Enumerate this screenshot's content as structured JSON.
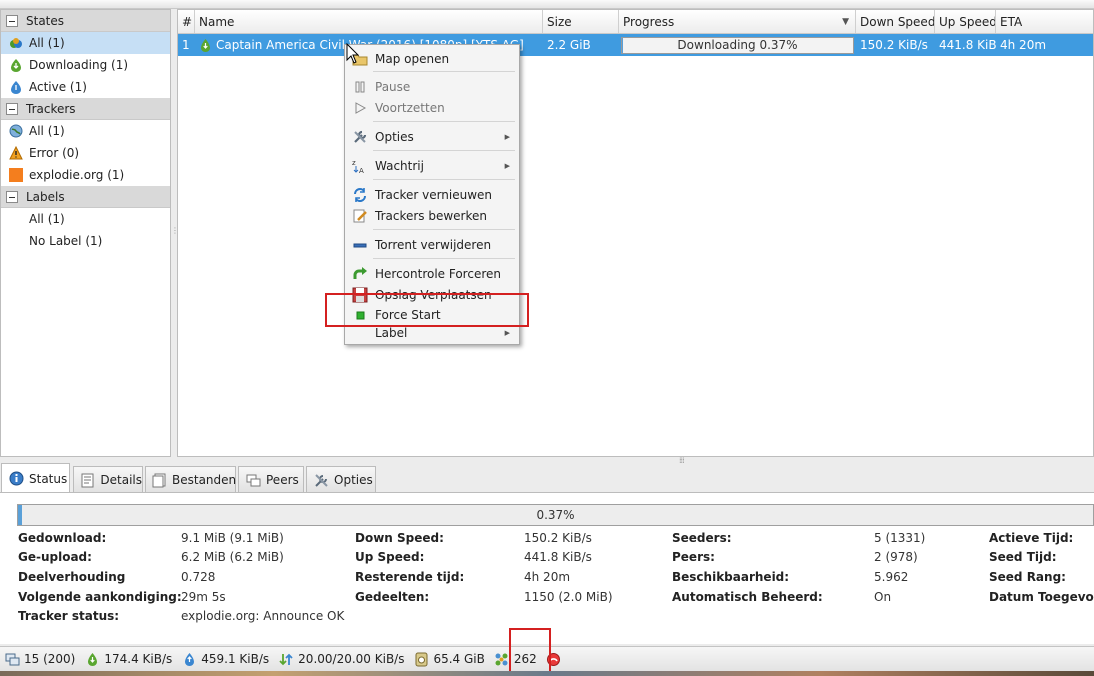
{
  "sidebar": {
    "states_title": "States",
    "states": [
      {
        "label": "All (1)"
      },
      {
        "label": "Downloading (1)"
      },
      {
        "label": "Active (1)"
      }
    ],
    "trackers_title": "Trackers",
    "trackers": [
      {
        "label": "All (1)"
      },
      {
        "label": "Error (0)"
      },
      {
        "label": "explodie.org (1)"
      }
    ],
    "labels_title": "Labels",
    "labels": [
      {
        "label": "All (1)"
      },
      {
        "label": "No Label (1)"
      }
    ]
  },
  "table": {
    "columns": [
      "#",
      "Name",
      "Size",
      "Progress",
      "Down Speed",
      "Up Speed",
      "ETA"
    ],
    "rows": [
      {
        "num": "1",
        "name": "Captain America Civil War (2016) [1080p] [YTS.AG]",
        "size": "2.2 GiB",
        "progress_text": "Downloading 0.37%",
        "progress": 0.0037,
        "down": "150.2 KiB/s",
        "up": "441.8 KiB/s",
        "eta": "4h 20m"
      }
    ]
  },
  "context_menu": {
    "items": {
      "open_folder": "Map openen",
      "pause": "Pause",
      "resume": "Voortzetten",
      "options": "Opties",
      "queue": "Wachtrij",
      "update_tracker": "Tracker vernieuwen",
      "edit_trackers": "Trackers bewerken",
      "remove_torrent": "Torrent verwijderen",
      "force_recheck": "Hercontrole Forceren",
      "move_storage": "Opslag Verplaatsen",
      "force_start": "Force Start",
      "label": "Label"
    }
  },
  "tabs": [
    "Status",
    "Details",
    "Bestanden",
    "Peers",
    "Opties"
  ],
  "status": {
    "progress_text": "0.37%",
    "progress": 0.0037,
    "col1": [
      {
        "label": "Gedownload:",
        "value": "9.1 MiB (9.1 MiB)"
      },
      {
        "label": "Ge-upload:",
        "value": "6.2 MiB (6.2 MiB)"
      },
      {
        "label": "Deelverhouding",
        "value": "0.728"
      },
      {
        "label": "Volgende aankondiging:",
        "value": "29m 5s"
      },
      {
        "label": "Tracker status:",
        "value": "explodie.org: Announce OK"
      }
    ],
    "col2": [
      {
        "label": "Down Speed:",
        "value": "150.2 KiB/s"
      },
      {
        "label": "Up Speed:",
        "value": "441.8 KiB/s"
      },
      {
        "label": "Resterende tijd:",
        "value": "4h 20m"
      },
      {
        "label": "Gedeelten:",
        "value": "1150 (2.0 MiB)"
      }
    ],
    "col3": [
      {
        "label": "Seeders:",
        "value": "5 (1331)"
      },
      {
        "label": "Peers:",
        "value": "2 (978)"
      },
      {
        "label": "Beschikbaarheid:",
        "value": "5.962"
      },
      {
        "label": "Automatisch Beheerd:",
        "value": "On"
      }
    ],
    "col4": [
      {
        "label": "Actieve Tijd:"
      },
      {
        "label": "Seed Tijd:"
      },
      {
        "label": "Seed Rang:"
      },
      {
        "label": "Datum Toegevoegd:"
      }
    ]
  },
  "statusbar": {
    "connections": "15 (200)",
    "download": "174.4 KiB/s",
    "upload": "459.1 KiB/s",
    "protocol": "20.00/20.00 KiB/s",
    "free_space": "65.4 GiB",
    "dht": "262"
  },
  "colors": {
    "selection": "#3f9be0",
    "highlight_box": "#d42020",
    "sidebar_selected": "#c6dff5"
  }
}
